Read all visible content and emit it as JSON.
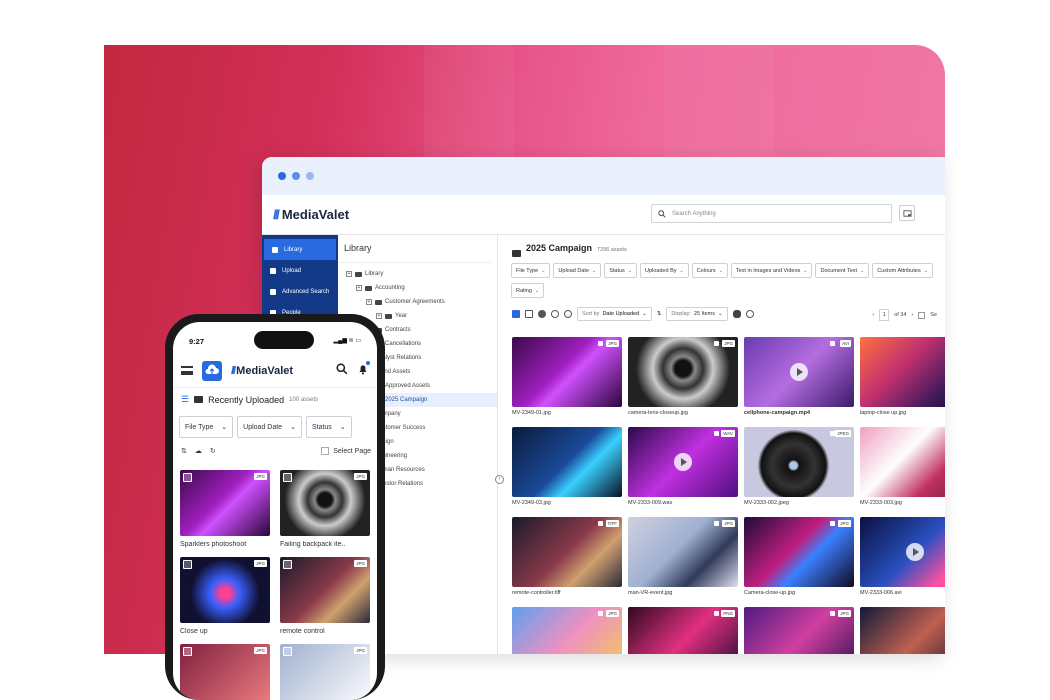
{
  "browser": {
    "brand": "MediaValet",
    "search_placeholder": "Search Anything",
    "sidebar": [
      {
        "label": "Library",
        "active": true
      },
      {
        "label": "Upload",
        "active": false
      },
      {
        "label": "Advanced Search",
        "active": false
      },
      {
        "label": "People",
        "active": false
      }
    ],
    "tree": {
      "title": "Library",
      "nodes": [
        {
          "label": "Library",
          "indent": 0,
          "selected": false
        },
        {
          "label": "Accounting",
          "indent": 1,
          "selected": false
        },
        {
          "label": "Customer Agreements",
          "indent": 2,
          "selected": false
        },
        {
          "label": "Year",
          "indent": 3,
          "selected": false
        },
        {
          "label": "Contracts",
          "indent": 2,
          "selected": false
        },
        {
          "label": "Cancellations",
          "indent": 2,
          "selected": false
        },
        {
          "label": "Analyst Relations",
          "indent": 1,
          "selected": false
        },
        {
          "label": "Brand Assets",
          "indent": 1,
          "selected": false
        },
        {
          "label": "Approved Assets",
          "indent": 2,
          "selected": false
        },
        {
          "label": "2025 Campaign",
          "indent": 2,
          "selected": true
        },
        {
          "label": "Company",
          "indent": 1,
          "selected": false
        },
        {
          "label": "Customer Success",
          "indent": 1,
          "selected": false
        },
        {
          "label": "Design",
          "indent": 1,
          "selected": false
        },
        {
          "label": "Engineering",
          "indent": 1,
          "selected": false
        },
        {
          "label": "Human Resources",
          "indent": 1,
          "selected": false
        },
        {
          "label": "Investor Relations",
          "indent": 1,
          "selected": false
        }
      ]
    },
    "main": {
      "title": "2025 Campaign",
      "count": "7296 assets",
      "filters": [
        "File Type",
        "Upload Date",
        "Status",
        "Uploaded By",
        "Colours",
        "Text in Images and Videos",
        "Document Text",
        "Custom Attributes",
        "Rating"
      ],
      "sort_label": "Sort by",
      "sort_value": "Date Uploaded",
      "display_label": "Display:",
      "display_value": "25 Items",
      "page_current": "1",
      "page_total": "of 34",
      "select_label": "Se"
    },
    "assets": [
      {
        "name": "MV-2349-01.jpg",
        "type": "JPG",
        "video": false,
        "g": "linear-gradient(135deg,#3a0a4a,#a020c0 45%,#d050ff 55%,#2a0638)"
      },
      {
        "name": "camera-lens-closeup.jpg",
        "type": "JPG",
        "video": false,
        "g": "radial-gradient(circle at 50% 45%,#111 12%,#888 18%,#333 30%,#ccc 45%,#222 70%)"
      },
      {
        "name": "cellphone-campaign.mp4",
        "type": "AVI",
        "video": true,
        "g": "linear-gradient(135deg,#6a3bb0,#b46de0 50%,#3a1a6a)"
      },
      {
        "name": "laptop-close up.jpg",
        "type": "",
        "video": false,
        "g": "linear-gradient(135deg,#ff7040,#c03070 40%,#401a5a 75%,#1a0a2a)"
      },
      {
        "name": "MV-2349-03.jpg",
        "type": "",
        "video": false,
        "g": "linear-gradient(135deg,#0a1a3a,#1a4a9a 50%,#3ad0ff 65%,#0a1020)"
      },
      {
        "name": "MV-2333-009.wav",
        "type": "WAV",
        "video": true,
        "g": "linear-gradient(135deg,#2a0a4a,#c030e0 50%,#501080)"
      },
      {
        "name": "MV-2333-002.jpeg",
        "type": "JPEG",
        "video": false,
        "g": "radial-gradient(circle at 45% 55%,#b0c8e0 5%,#111 8%,#333 30%,#111 45%,#c8c8e0 50%)"
      },
      {
        "name": "MV-2333-003.jpg",
        "type": "",
        "video": false,
        "g": "linear-gradient(135deg,#f0a0c0,#ffffff 40%,#c03060 70%,#702040)"
      },
      {
        "name": "remote-controller.tiff",
        "type": "TIFF",
        "video": false,
        "g": "linear-gradient(135deg,#1a1a2a,#8a3a4a 50%,#d0a070 70%,#2a2a3a)"
      },
      {
        "name": "man-VR-event.jpg",
        "type": "JPG",
        "video": false,
        "g": "linear-gradient(135deg,#d0d0e0,#a0b0d0 45%,#303a5a 70%,#e0e0f0)"
      },
      {
        "name": "Camera-close-up.jpg",
        "type": "JPG",
        "video": false,
        "g": "linear-gradient(135deg,#200a3a,#c02080 45%,#3a80ff 60%,#100a20)"
      },
      {
        "name": "MV-2333-006.avi",
        "type": "",
        "video": true,
        "g": "linear-gradient(135deg,#0a1040,#2a50c0 50%,#ff50a0 80%)"
      },
      {
        "name": "",
        "type": "JPG",
        "video": false,
        "g": "linear-gradient(135deg,#60a0f0,#f090c0 50%,#f0d050)"
      },
      {
        "name": "",
        "type": "PNG",
        "video": false,
        "g": "linear-gradient(135deg,#300a20,#e03080 50%,#200a30)"
      },
      {
        "name": "",
        "type": "JPG",
        "video": false,
        "g": "linear-gradient(135deg,#501a80,#d040a0 50%,#301050)"
      },
      {
        "name": "",
        "type": "",
        "video": false,
        "g": "linear-gradient(135deg,#101a3a,#c06050 50%,#0a1030)"
      }
    ]
  },
  "phone": {
    "time": "9:27",
    "brand": "MediaValet",
    "section_title": "Recently Uploaded",
    "section_count": "100 assets",
    "filters": [
      "File Type",
      "Upload Date",
      "Status"
    ],
    "select_page": "Select Page",
    "items": [
      {
        "name": "Sparklers photoshoot",
        "type": "JPG",
        "g": "linear-gradient(135deg,#3a0a4a,#a020c0 45%,#d050ff 55%,#2a0638)"
      },
      {
        "name": "Failing backpack ite..",
        "type": "JPG",
        "g": "radial-gradient(circle at 50% 45%,#111 12%,#888 18%,#333 30%,#ccc 45%,#222 70%)"
      },
      {
        "name": "Close up",
        "type": "JPG",
        "g": "radial-gradient(circle at 50% 55%,#ff4090 8%,#3a60ff 25%,#101030 60%)"
      },
      {
        "name": "remote control",
        "type": "JPG",
        "g": "linear-gradient(135deg,#1a1a2a,#8a3a4a 50%,#d0a070 70%,#2a2a3a)"
      },
      {
        "name": "",
        "type": "JPG",
        "g": "linear-gradient(135deg,#802040,#f08080)"
      },
      {
        "name": "",
        "type": "JPG",
        "g": "linear-gradient(135deg,#a0b0d0,#ffffff)"
      }
    ]
  },
  "colors": {
    "accent": "#2a6ae0",
    "sidebar": "#123a88",
    "bg_left": "#c1283f",
    "bg_right": "#f07aa6"
  }
}
